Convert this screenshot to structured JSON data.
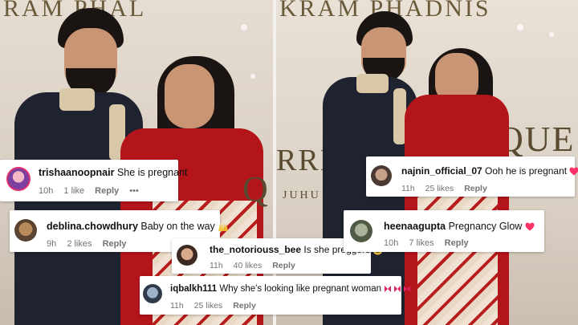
{
  "backdrop": {
    "left_top_text": "RAM PHAL",
    "right_top_text": "KRAM PHADNIS",
    "right_mid_text": "RRIC",
    "right_mid_text2": "QUE",
    "right_small_text": "JUHU"
  },
  "comments": [
    {
      "username": "trishaanoopnair",
      "text": "She is pregnant",
      "time": "10h",
      "likes": "1 like",
      "reply": "Reply",
      "more": "•••",
      "emoji": ""
    },
    {
      "username": "deblina.chowdhury",
      "text": "Baby on the way",
      "time": "9h",
      "likes": "2 likes",
      "reply": "Reply",
      "more": "",
      "emoji": "raised-hands"
    },
    {
      "username": "the_notoriouss_bee",
      "text": "Is she preggers",
      "time": "11h",
      "likes": "40 likes",
      "reply": "Reply",
      "more": "",
      "emoji": "heart-eyes"
    },
    {
      "username": "iqbalkh111",
      "text": "Why she's looking like pregnant woman",
      "time": "11h",
      "likes": "25 likes",
      "reply": "Reply",
      "more": "",
      "emoji": "red-bows"
    },
    {
      "username": "najnin_official_07",
      "text": "Ooh he is pregnant",
      "time": "11h",
      "likes": "25 likes",
      "reply": "Reply",
      "more": "",
      "emoji": "heart"
    },
    {
      "username": "heenaagupta",
      "text": "Pregnancy Glow",
      "time": "10h",
      "likes": "7 likes",
      "reply": "Reply",
      "more": "",
      "emoji": "heart"
    }
  ],
  "colors": {
    "heart": "#ff3366",
    "bow": "#e0245e",
    "meta": "#737373"
  }
}
